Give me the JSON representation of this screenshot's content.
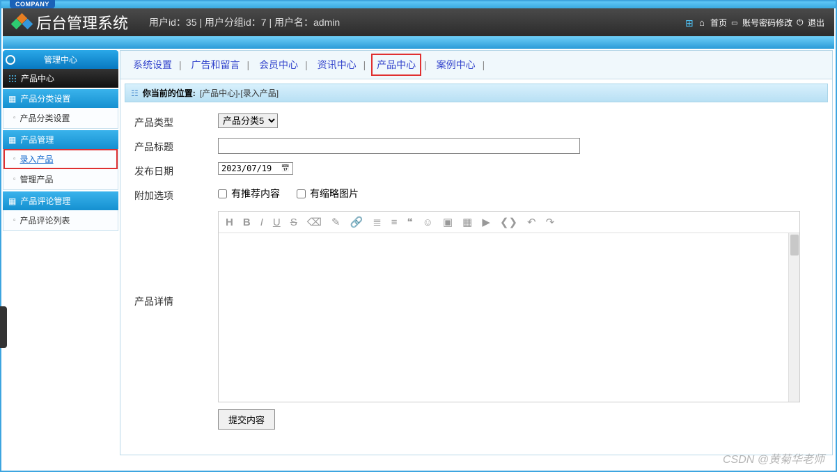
{
  "company_tag": "COMPANY",
  "header": {
    "title": "后台管理系统",
    "user_info": "用户id：35 | 用户分组id：7 | 用户名：admin",
    "links": {
      "home": "首页",
      "password": "账号密码修改",
      "logout": "退出"
    }
  },
  "sidebar": {
    "title": "管理中心",
    "module": "产品中心",
    "sections": [
      {
        "title": "产品分类设置",
        "items": [
          "产品分类设置"
        ]
      },
      {
        "title": "产品管理",
        "items": [
          "录入产品",
          "管理产品"
        ],
        "highlight_index": 0
      },
      {
        "title": "产品评论管理",
        "items": [
          "产品评论列表"
        ]
      }
    ]
  },
  "topnav": {
    "items": [
      "系统设置",
      "广告和留言",
      "会员中心",
      "资讯中心",
      "产品中心",
      "案例中心"
    ],
    "highlight_index": 4
  },
  "breadcrumb": {
    "label": "你当前的位置:",
    "path": "[产品中心]-[录入产品]"
  },
  "form": {
    "type_label": "产品类型",
    "type_value": "产品分类5",
    "title_label": "产品标题",
    "title_value": "",
    "date_label": "发布日期",
    "date_value": "2023/07/19",
    "extra_label": "附加选项",
    "chk_recommend": "有推荐内容",
    "chk_thumb": "有缩略图片",
    "detail_label": "产品详情",
    "submit": "提交内容"
  },
  "editor_icons": {
    "h": "H",
    "b": "B",
    "i": "I",
    "u": "U",
    "s": "S",
    "eraser": "⌫",
    "brush": "✎",
    "link": "🔗",
    "ul": "≣",
    "ol": "≡",
    "quote": "❝",
    "smile": "☺",
    "img": "▣",
    "table": "▦",
    "video": "▶",
    "code": "❮❯",
    "undo": "↶",
    "redo": "↷"
  },
  "watermark": "CSDN @黄菊华老师"
}
